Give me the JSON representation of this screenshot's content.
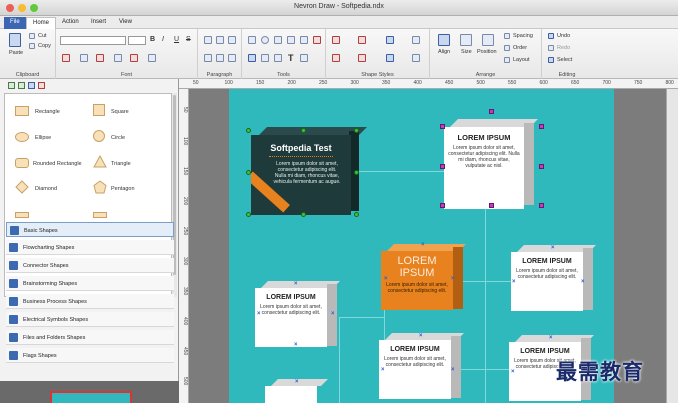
{
  "window": {
    "title": "Nevron Draw - Softpedia.ndx"
  },
  "menu": {
    "tabs": [
      "File",
      "Home",
      "Action",
      "Insert",
      "View"
    ]
  },
  "ribbon": {
    "clipboard": {
      "paste": "Paste",
      "cut": "Cut",
      "copy": "Copy",
      "label": "Clipboard"
    },
    "font": {
      "label": "Font",
      "bold": "B",
      "italic": "I",
      "underline": "U",
      "strike": "S"
    },
    "paragraph": {
      "label": "Paragraph"
    },
    "tools": {
      "label": "Tools",
      "text_tool": "T"
    },
    "shape_styles": {
      "label": "Shape Styles"
    },
    "arrange": {
      "label": "Arrange",
      "align": "Align",
      "size": "Size",
      "position": "Position",
      "spacing": "Spacing",
      "order": "Order",
      "layout": "Layout"
    },
    "editing": {
      "label": "Editing",
      "undo": "Undo",
      "redo": "Redo",
      "select": "Select"
    }
  },
  "ruler_top": [
    "50",
    "100",
    "150",
    "200",
    "250",
    "300",
    "350",
    "400",
    "450",
    "500",
    "550",
    "600",
    "650",
    "700",
    "750",
    "800"
  ],
  "ruler_left": [
    "50",
    "100",
    "150",
    "200",
    "250",
    "300",
    "350",
    "400",
    "450",
    "500"
  ],
  "shapes": {
    "items": [
      "Rectangle",
      "Square",
      "Ellipse",
      "Circle",
      "Rounded Rectangle",
      "Triangle",
      "Diamond",
      "Pentagon"
    ]
  },
  "categories": [
    "Basic Shapes",
    "Flowcharting Shapes",
    "Connector Shapes",
    "Brainstorming Shapes",
    "Business Process Shapes",
    "Electrical Symbols Shapes",
    "Files and Folders Shapes",
    "Flags Shapes"
  ],
  "diagram": {
    "main_title": "Softpedia Test",
    "main_text": "Lorem ipsum dolor sit amet, consectetur adipiscing elit. Nulla mi diam, rhoncus vitae, vehicula fermentum ac augue.",
    "top_title": "LOREM IPSUM",
    "top_text": "Lorem ipsum dolor sit amet, consectetur adipiscing elit. Nulla mi diam, rhoncus vitae, vulputate ac nisl.",
    "orange_title": "LOREM IPSUM",
    "orange_text": "Lorem ipsum dolor sit amet, consectetur adipiscing elit.",
    "right_title": "LOREM IPSUM",
    "right_text": "Lorem ipsum dolor sit amet, consectetur adipiscing elit.",
    "left_title": "LOREM IPSUM",
    "left_text": "Lorem ipsum dolor sit amet, consectetur adipiscing elit.",
    "mid_title": "LOREM IPSUM",
    "mid_text": "Lorem ipsum dolor sit amet, consectetur adipiscing elit.",
    "br_title": "LOREM IPSUM",
    "br_text": "Lorem ipsum dolor sit amet, consectetur adipiscing elit."
  },
  "watermark": "最需教育",
  "colors": {
    "canvas": "#2fb9bd",
    "accent": "#3a66b3",
    "orange": "#e8821e",
    "dark_box": "#1f3a3b"
  }
}
